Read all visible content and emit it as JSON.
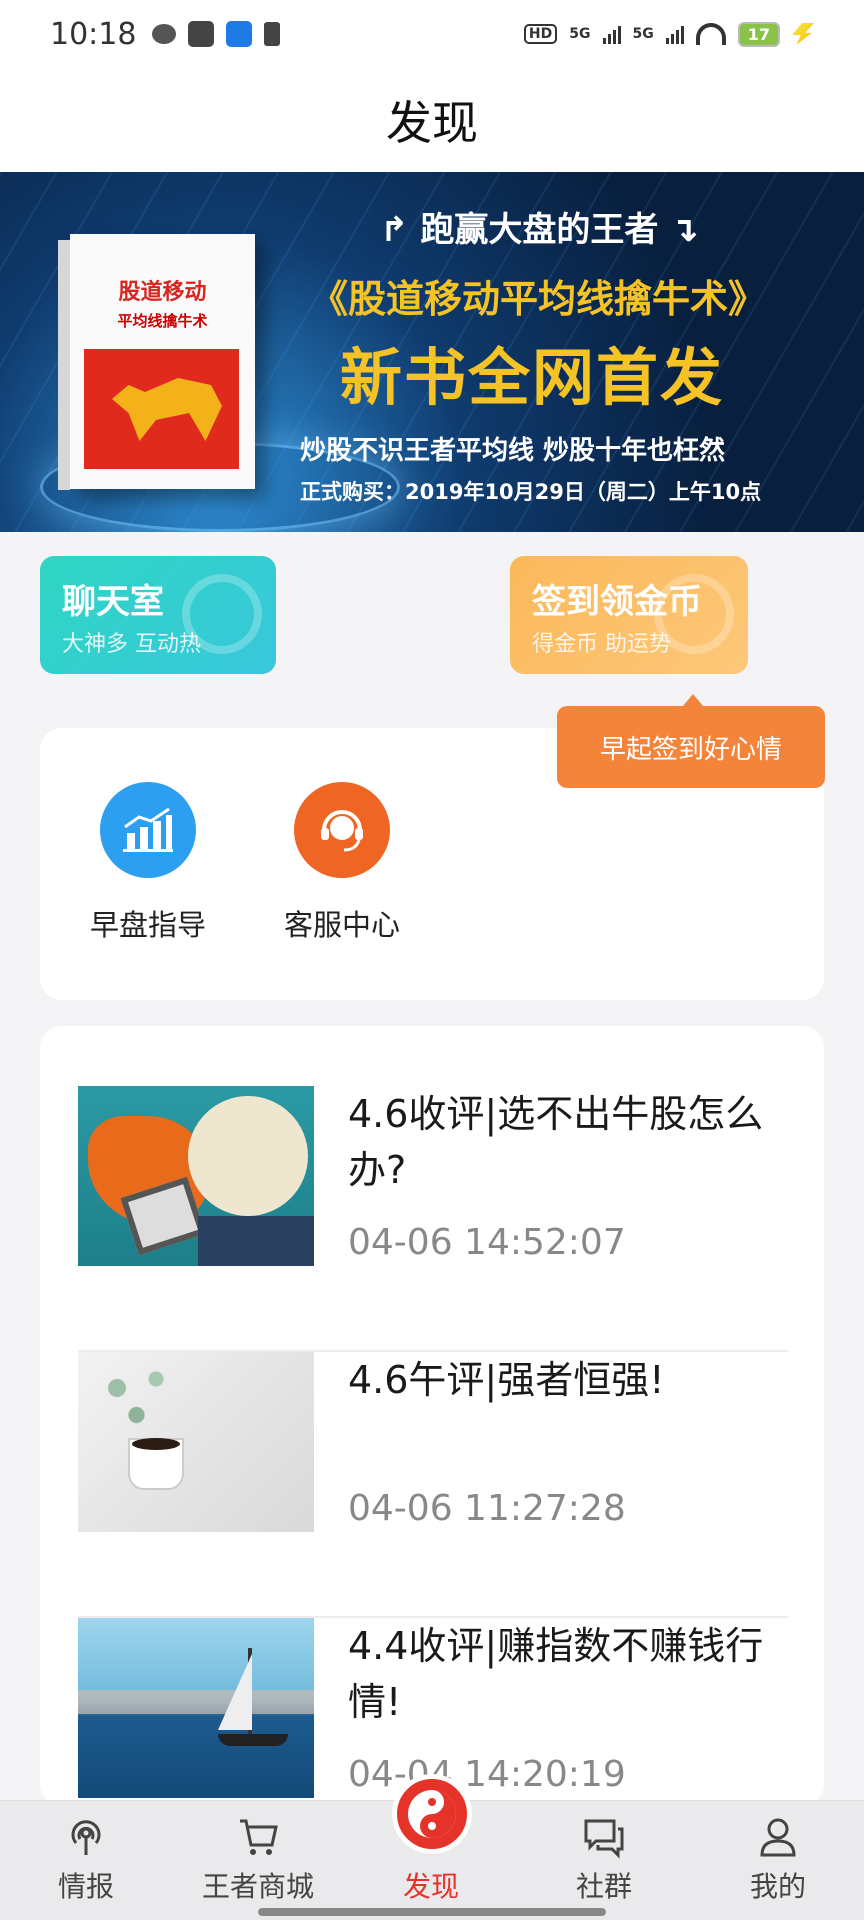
{
  "status_bar": {
    "time": "10:18",
    "network_1": "5G",
    "network_2": "5G",
    "battery": "17"
  },
  "header": {
    "title": "发现"
  },
  "banner": {
    "book_title": "股道移动",
    "book_subtitle": "平均线擒牛术",
    "line1": "跑赢大盘的王者",
    "line2": "《股道移动平均线擒牛术》",
    "line3": "新书全网首发",
    "line4": "炒股不识王者平均线  炒股十年也枉然",
    "line5": "正式购买：2019年10月29日（周二）上午10点"
  },
  "promos": {
    "chat": {
      "title": "聊天室",
      "subtitle": "大神多 互动热",
      "color": "#2fd6c3"
    },
    "sign": {
      "title": "签到领金币",
      "subtitle": "得金币 助运势",
      "color": "#fbb85a"
    },
    "tooltip": "早起签到好心情"
  },
  "quick_links": [
    {
      "label": "早盘指导",
      "icon": "chart-icon",
      "color": "#2c9ff0"
    },
    {
      "label": "客服中心",
      "icon": "headset-icon",
      "color": "#ef6624"
    }
  ],
  "news": [
    {
      "title": "4.6收评|选不出牛股怎么办?",
      "time": "04-06 14:52:07"
    },
    {
      "title": "4.6午评|强者恒强!",
      "time": "04-06 11:27:28"
    },
    {
      "title": "4.4收评|赚指数不赚钱行情!",
      "time": "04-04 14:20:19"
    }
  ],
  "nav": [
    {
      "label": "情报",
      "icon": "podcast-icon"
    },
    {
      "label": "王者商城",
      "icon": "cart-icon"
    },
    {
      "label": "发现",
      "icon": "yin-yang-icon",
      "active": true
    },
    {
      "label": "社群",
      "icon": "chat-bubbles-icon"
    },
    {
      "label": "我的",
      "icon": "user-icon"
    }
  ],
  "colors": {
    "accent": "#e5332a",
    "orange": "#f5843b"
  }
}
